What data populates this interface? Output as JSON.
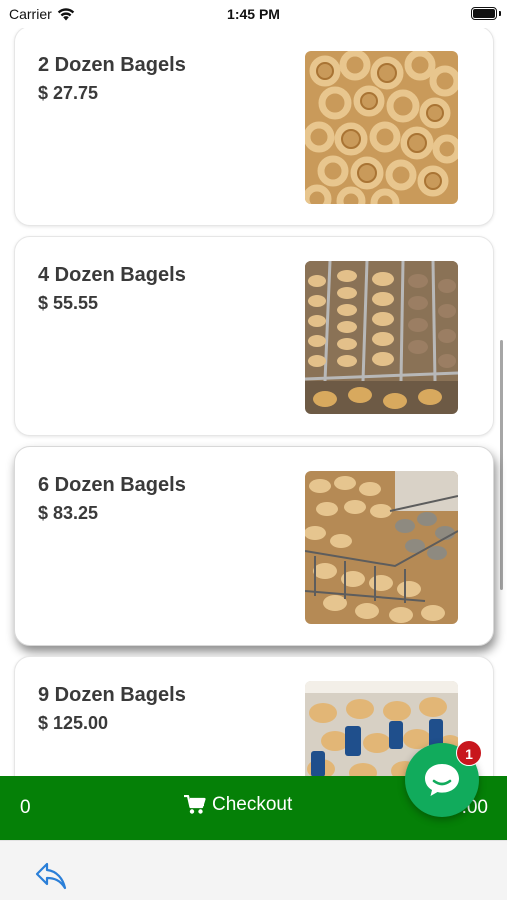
{
  "status_bar": {
    "carrier": "Carrier",
    "time": "1:45 PM"
  },
  "products": [
    {
      "title": "2 Dozen Bagels",
      "price": "$ 27.75",
      "image": "bagels-pile-photo"
    },
    {
      "title": "4 Dozen Bagels",
      "price": "$ 55.55",
      "image": "bagels-display-racks-photo"
    },
    {
      "title": "6 Dozen Bagels",
      "price": "$ 83.25",
      "image": "bagels-wire-baskets-photo"
    },
    {
      "title": "9 Dozen Bagels",
      "price": "$ 125.00",
      "image": "bagels-packaged-bags-photo"
    }
  ],
  "checkout": {
    "count": "0",
    "label": "Checkout",
    "total": "0.00",
    "icon": "cart-icon"
  },
  "chat": {
    "badge": "1",
    "icon": "chat-icon"
  },
  "nav": {
    "back_icon": "reply-back-icon"
  },
  "colors": {
    "checkout_bar": "#058007",
    "chat_button": "#11ab5c",
    "badge": "#c8161d",
    "back_icon": "#2b7fd8"
  }
}
